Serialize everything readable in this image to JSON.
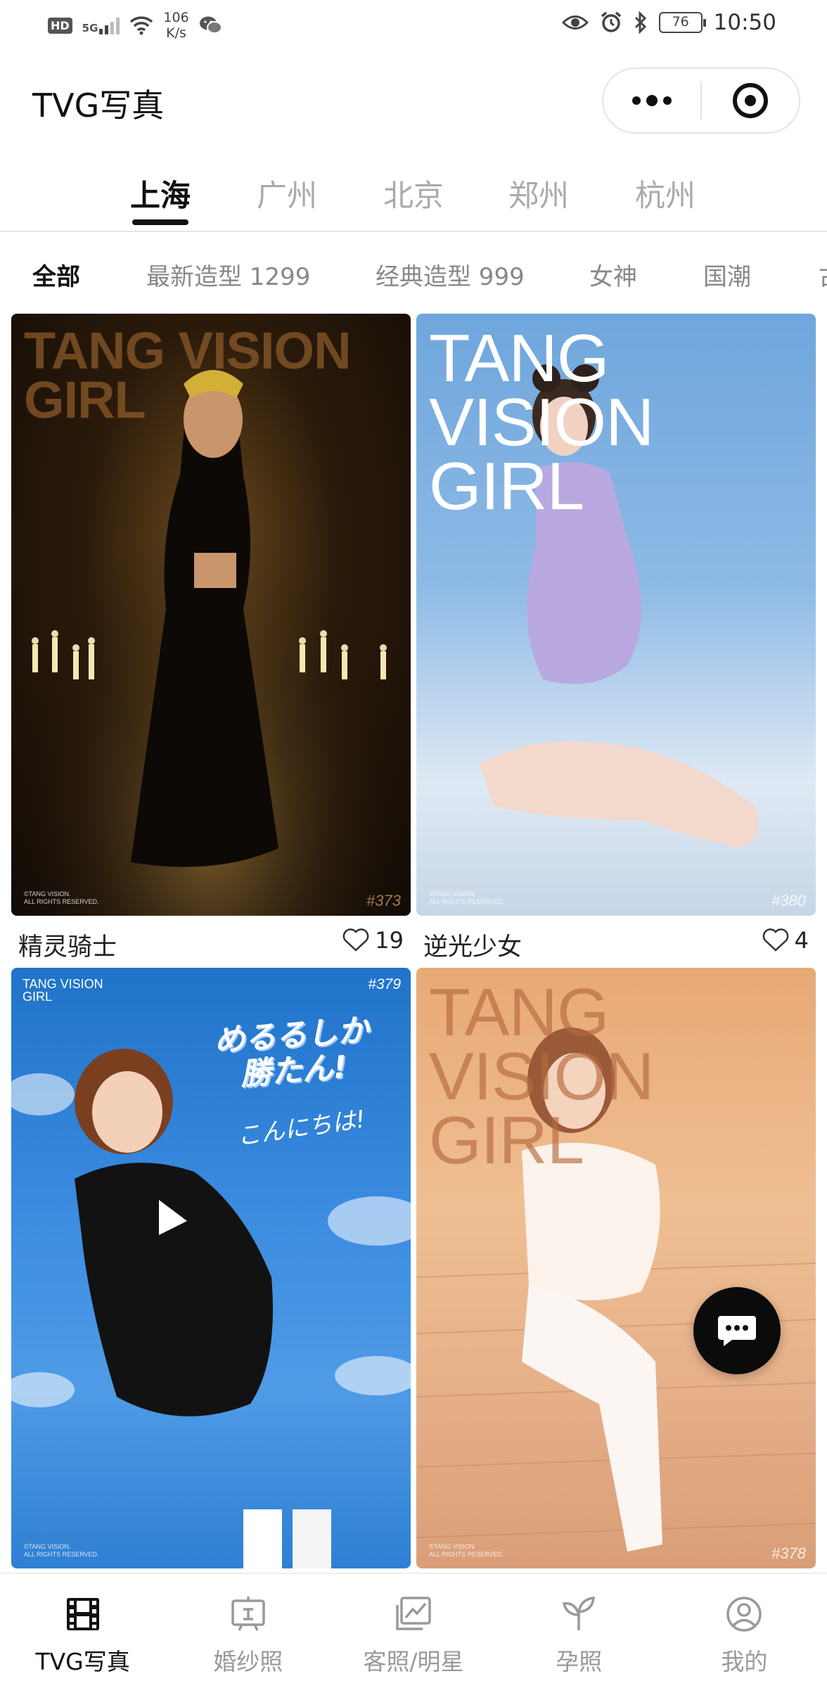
{
  "status_bar": {
    "hd": "HD",
    "network": "5G",
    "speed_value": "106",
    "speed_unit": "K/s",
    "battery": "76",
    "time": "10:50"
  },
  "title_bar": {
    "title": "TVG写真"
  },
  "city_tabs": [
    "上海",
    "广州",
    "北京",
    "郑州",
    "杭州"
  ],
  "categories": [
    "全部",
    "最新造型 1299",
    "经典造型 999",
    "女神",
    "国潮",
    "古"
  ],
  "cards": [
    {
      "watermark_line1": "TANG VISION",
      "watermark_line2": "GIRL",
      "number": "#373",
      "copyright_1": "©TANG VISION.",
      "copyright_2": "ALL RIGHTS RESERVED."
    },
    {
      "watermark_line1": "TANG VISION",
      "watermark_line2": "GIRL",
      "number": "#380",
      "copyright_1": "©TANG VISION.",
      "copyright_2": "ALL RIGHTS RESERVED."
    },
    {
      "watermark_line1": "TANG VISION",
      "watermark_line2": "GIRL",
      "number": "#379",
      "copyright_1": "©TANG VISION.",
      "copyright_2": "ALL RIGHTS RESERVED.",
      "handwriting_1": "めるるしか",
      "handwriting_2": "勝たん!",
      "handwriting_3": "こんにちは!"
    },
    {
      "watermark_line1": "TANG VISION",
      "watermark_line2": "GIRL",
      "number": "#378",
      "copyright_1": "©TANG VISION.",
      "copyright_2": "ALL RIGHTS RESERVED."
    }
  ],
  "card_meta": [
    {
      "name": "精灵骑士",
      "likes": "19"
    },
    {
      "name": "逆光少女",
      "likes": "4"
    }
  ],
  "bottom_nav": [
    {
      "label": "TVG写真",
      "icon": "film-icon"
    },
    {
      "label": "婚纱照",
      "icon": "frame-icon"
    },
    {
      "label": "客照/明星",
      "icon": "gallery-icon"
    },
    {
      "label": "孕照",
      "icon": "sprout-icon"
    },
    {
      "label": "我的",
      "icon": "user-icon"
    }
  ],
  "colors": {
    "accent": "#111111",
    "inactive": "#999999",
    "fab": "#0b0b0b"
  }
}
